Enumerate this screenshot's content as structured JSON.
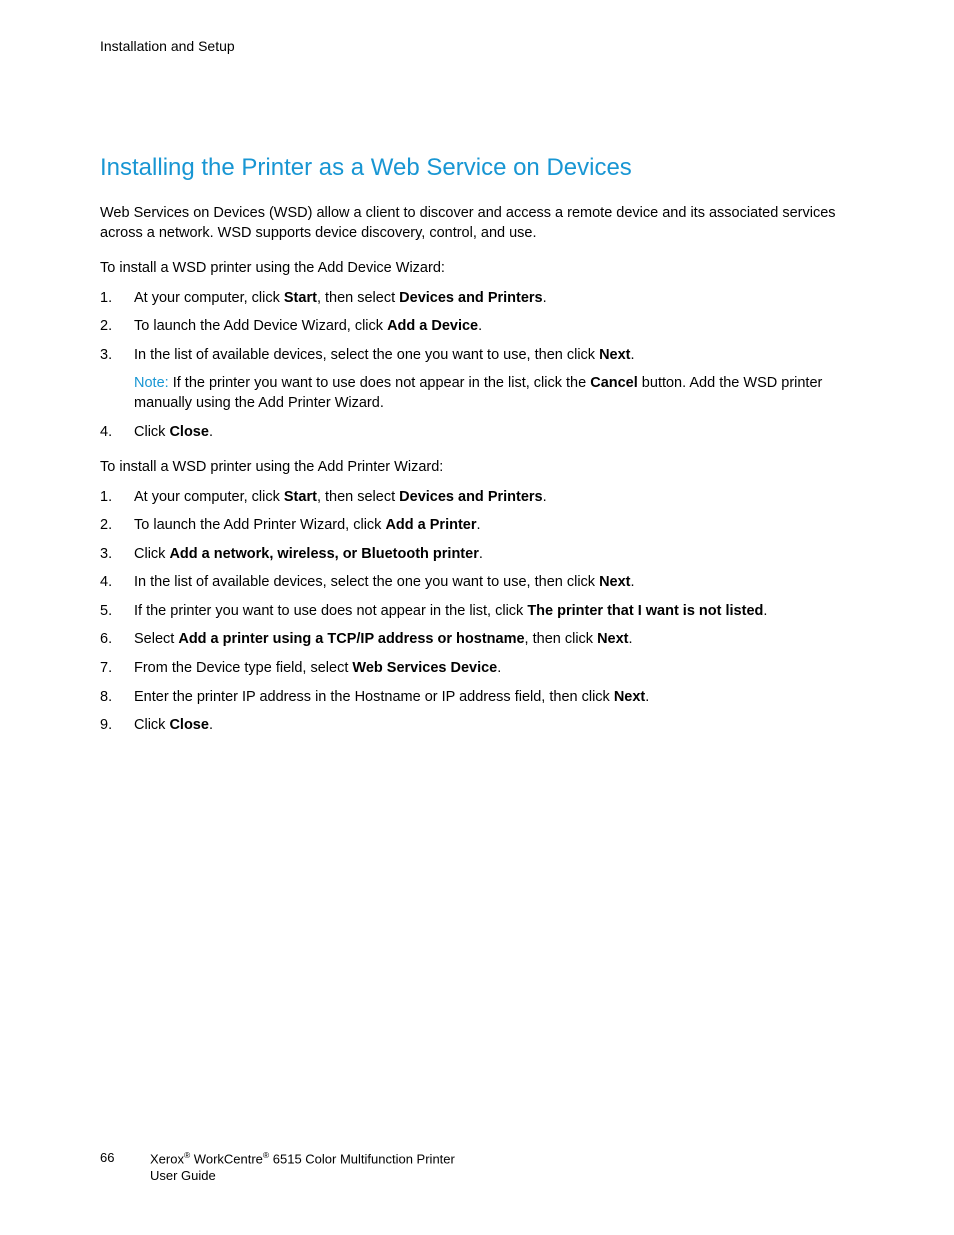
{
  "chapter": "Installation and Setup",
  "heading": "Installing the Printer as a Web Service on Devices",
  "intro": "Web Services on Devices (WSD) allow a client to discover and access a remote device and its associated services across a network. WSD supports device discovery, control, and use.",
  "section1": {
    "lead": "To install a WSD printer using the Add Device Wizard:",
    "s1_pre": "At your computer, click ",
    "s1_b1": "Start",
    "s1_mid": ", then select ",
    "s1_b2": "Devices and Printers",
    "s1_post": ".",
    "s2_pre": "To launch the Add Device Wizard, click ",
    "s2_b1": "Add a Device",
    "s2_post": ".",
    "s3_pre": "In the list of available devices, select the one you want to use, then click ",
    "s3_b1": "Next",
    "s3_post": ".",
    "note_label": "Note:",
    "note_pre": " If the printer you want to use does not appear in the list, click the ",
    "note_b1": "Cancel",
    "note_post": " button. Add the WSD printer manually using the Add Printer Wizard.",
    "s4_pre": "Click ",
    "s4_b1": "Close",
    "s4_post": "."
  },
  "section2": {
    "lead": "To install a WSD printer using the Add Printer Wizard:",
    "s1_pre": "At your computer, click ",
    "s1_b1": "Start",
    "s1_mid": ", then select ",
    "s1_b2": "Devices and Printers",
    "s1_post": ".",
    "s2_pre": "To launch the Add Printer Wizard, click ",
    "s2_b1": "Add a Printer",
    "s2_post": ".",
    "s3_pre": "Click ",
    "s3_b1": "Add a network, wireless, or Bluetooth printer",
    "s3_post": ".",
    "s4_pre": "In the list of available devices, select the one you want to use, then click ",
    "s4_b1": "Next",
    "s4_post": ".",
    "s5_pre": "If the printer you want to use does not appear in the list, click ",
    "s5_b1": "The printer that I want is not listed",
    "s5_post": ".",
    "s6_pre": "Select ",
    "s6_b1": "Add a printer using a TCP/IP address or hostname",
    "s6_mid": ", then click ",
    "s6_b2": "Next",
    "s6_post": ".",
    "s7_pre": "From the Device type field, select ",
    "s7_b1": "Web Services Device",
    "s7_post": ".",
    "s8_pre": "Enter the printer IP address in the Hostname or IP address field, then click ",
    "s8_b1": "Next",
    "s8_post": ".",
    "s9_pre": "Click ",
    "s9_b1": "Close",
    "s9_post": "."
  },
  "footer": {
    "page": "66",
    "line1_a": "Xerox",
    "line1_b": " WorkCentre",
    "line1_c": " 6515 Color Multifunction Printer",
    "line2": "User Guide",
    "reg": "®"
  }
}
